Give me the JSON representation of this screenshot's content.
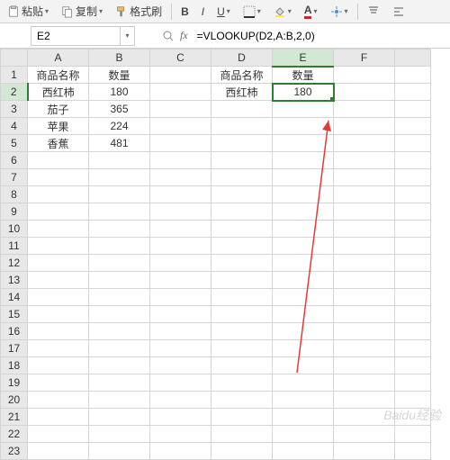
{
  "toolbar": {
    "paste_label": "粘贴",
    "copy_label": "复制",
    "format_painter_label": "格式刷"
  },
  "namebox": {
    "value": "E2"
  },
  "formula": {
    "value": "=VLOOKUP(D2,A:B,2,0)"
  },
  "columns": [
    "A",
    "B",
    "C",
    "D",
    "E",
    "F"
  ],
  "row_count": 23,
  "active_cell": {
    "row": 2,
    "col": "E"
  },
  "cells": {
    "A1": "商品名称",
    "B1": "数量",
    "A2": "西红柿",
    "B2": "180",
    "A3": "茄子",
    "B3": "365",
    "A4": "苹果",
    "B4": "224",
    "A5": "香蕉",
    "B5": "481",
    "D1": "商品名称",
    "E1": "数量",
    "D2": "西红柿",
    "E2": "180"
  },
  "watermark": "Baidu经验"
}
